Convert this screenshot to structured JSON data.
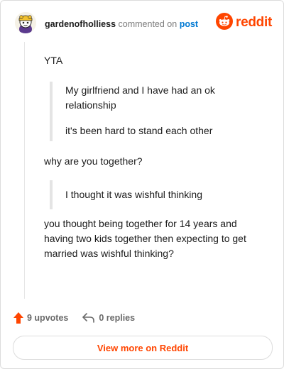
{
  "header": {
    "username": "gardenofholliess",
    "action_text": "commented on",
    "post_link": "post",
    "brand": "reddit"
  },
  "comment": {
    "reply": "YTA",
    "quote1_line1": "My girlfriend and I have had an ok relationship",
    "quote1_line2": "it's been hard to stand each other",
    "question": "why are you together?",
    "quote2": "I thought it was wishful thinking",
    "closing": "you thought being together for 14 years and having two kids together then expecting to get married was wishful thinking?"
  },
  "footer": {
    "upvotes": "9 upvotes",
    "replies": "0 replies"
  },
  "cta": {
    "label": "View more on Reddit"
  },
  "colors": {
    "brand": "#ff4500",
    "link": "#0079d3",
    "muted": "#7c7c7c"
  },
  "icons": [
    "avatar",
    "reddit-logo-icon",
    "upvote-arrow-icon",
    "reply-icon"
  ]
}
